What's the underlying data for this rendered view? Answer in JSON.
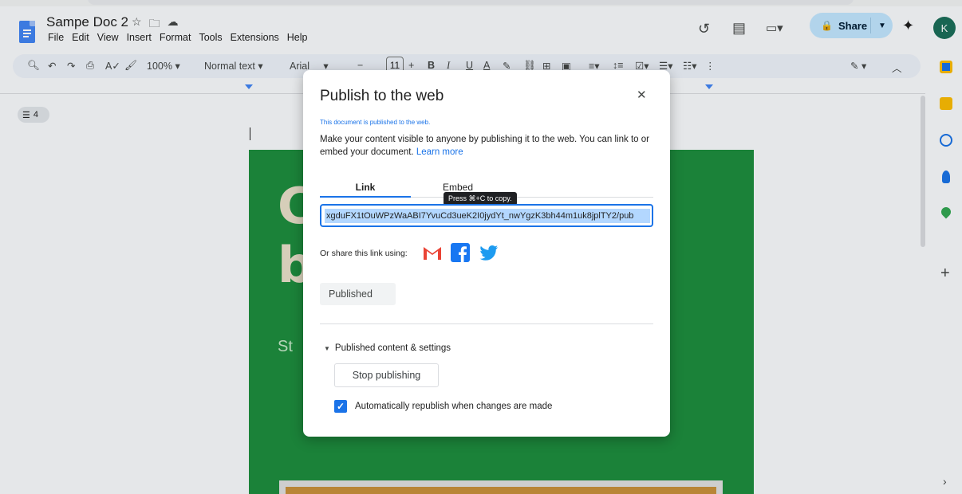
{
  "header": {
    "doc_title": "Sampe Doc 2",
    "menu": [
      "File",
      "Edit",
      "View",
      "Insert",
      "Format",
      "Tools",
      "Extensions",
      "Help"
    ],
    "share_label": "Share",
    "avatar_initial": "K"
  },
  "toolbar": {
    "zoom": "100%",
    "style": "Normal text",
    "font": "Arial",
    "font_size": "11"
  },
  "outline": {
    "count": "4"
  },
  "document": {
    "big_letters": [
      "C",
      "b"
    ],
    "subtitle_fragment": "St"
  },
  "dialog": {
    "title": "Publish to the web",
    "status": "This document is published to the web.",
    "description": "Make your content visible to anyone by publishing it to the web. You can link to or embed your document.",
    "learn_more": "Learn more",
    "tabs": [
      {
        "label": "Link",
        "active": true
      },
      {
        "label": "Embed",
        "active": false
      }
    ],
    "tooltip": "Press ⌘+C to copy.",
    "link_value": "xgduFX1tOuWPzWaABI7YvuCd3ueK2I0jydYt_nwYgzK3bh44m1uk8jplTY2/pub",
    "share_using": "Or share this link using:",
    "published_label": "Published",
    "section_label": "Published content & settings",
    "stop_label": "Stop publishing",
    "auto_republish": {
      "label": "Automatically republish when changes are made",
      "checked": true
    }
  },
  "colors": {
    "accent": "#1a73e8",
    "share_bg": "#c2e7ff",
    "doc_green": "#1e8e3e"
  }
}
